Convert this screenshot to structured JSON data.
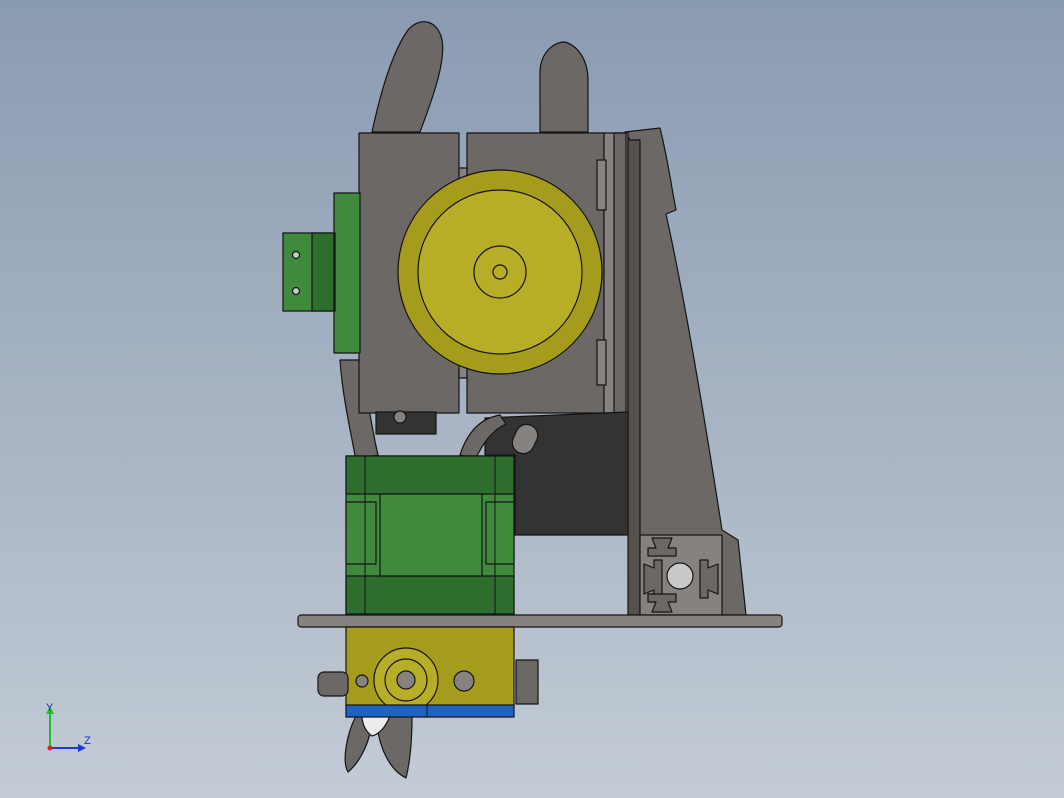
{
  "viewport": {
    "background_top": "#8a9bb1",
    "background_bottom": "#c3ccd6"
  },
  "colors": {
    "gray_part": "#6c6865",
    "gray_dark": "#55514f",
    "gray_light": "#858280",
    "yellow_part": "#a59c1c",
    "yellow_light": "#b8ad26",
    "green_part": "#3f8a3c",
    "green_dark": "#2d6e2c",
    "blue_part": "#1c64c4",
    "black_part": "#333333",
    "edge": "#141414"
  },
  "triad": {
    "y_label": "Y",
    "z_label": "Z",
    "y_color": "#1fbf2a",
    "z_color": "#2236d6",
    "x_color": "#d22"
  }
}
